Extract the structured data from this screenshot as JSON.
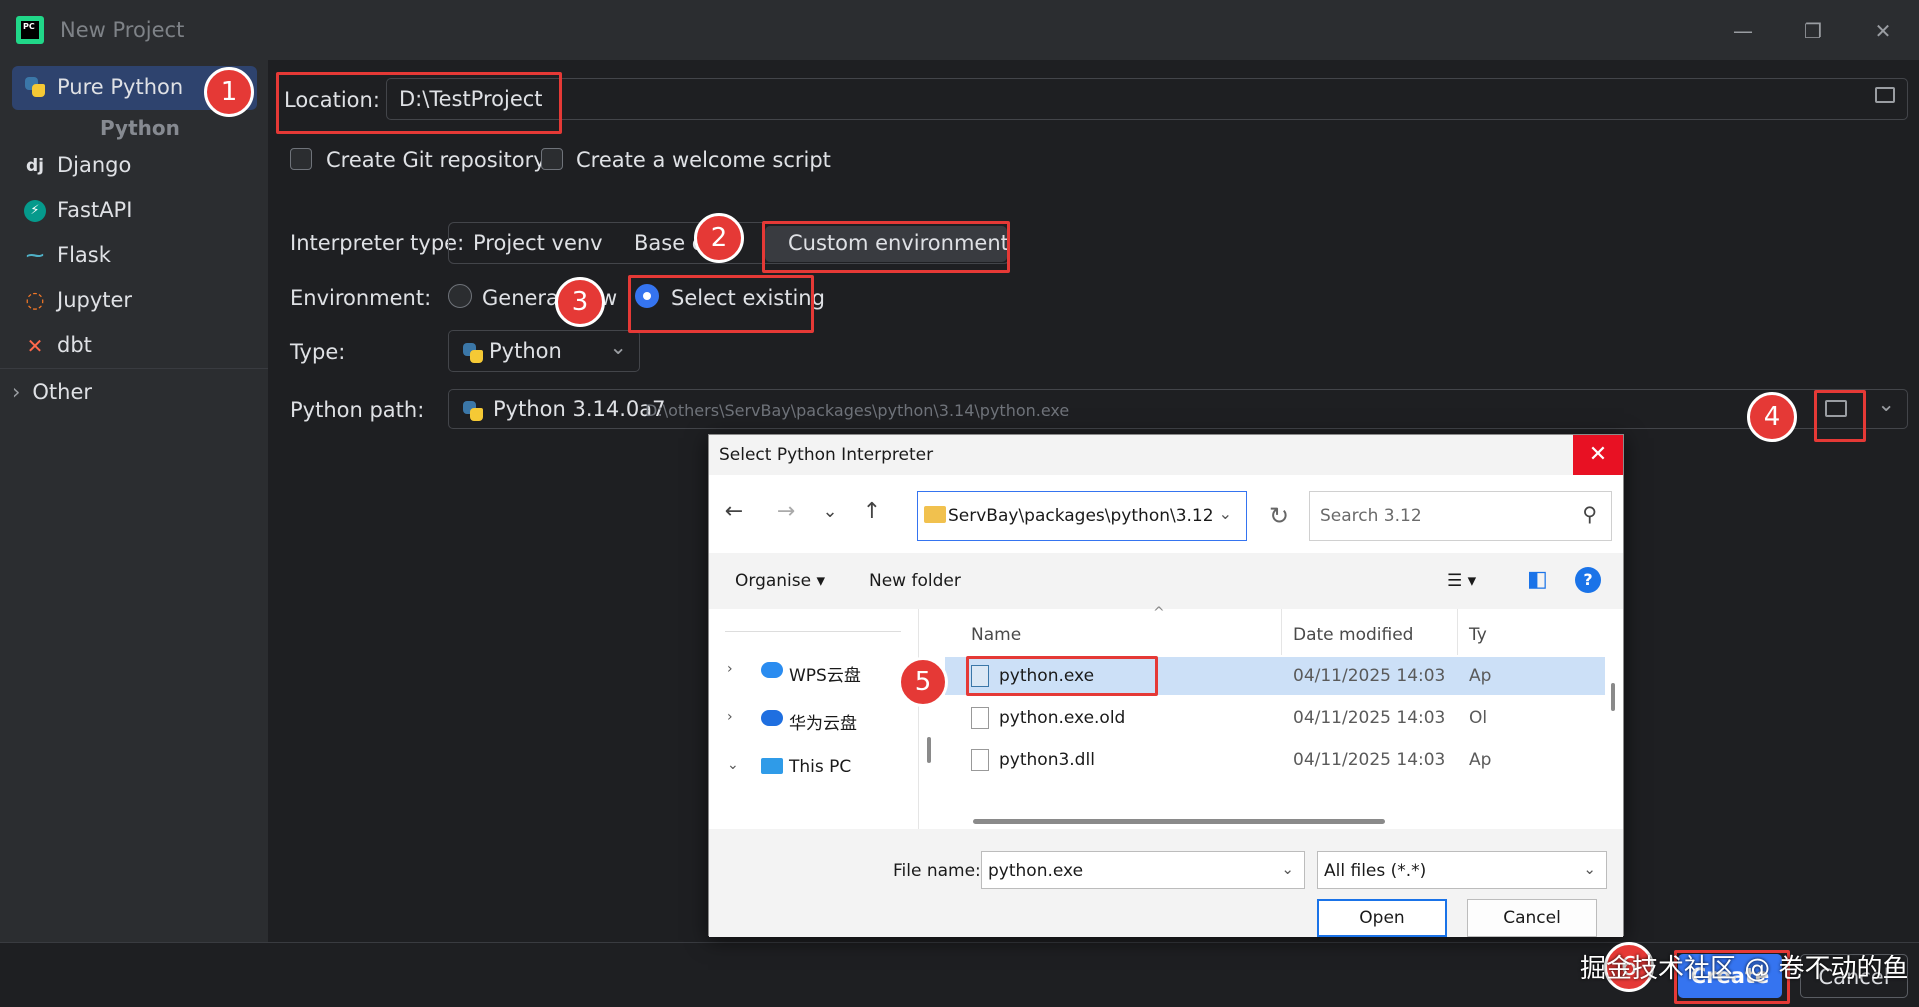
{
  "window": {
    "title": "New Project",
    "minimize": "—",
    "restore": "❐",
    "close": "✕"
  },
  "sidebar": {
    "items": [
      {
        "label": "Pure Python",
        "icon": "python-icon"
      },
      {
        "label": "Django",
        "icon": "django-icon",
        "glyph": "dj"
      },
      {
        "label": "FastAPI",
        "icon": "fastapi-icon",
        "glyph": "⚡"
      },
      {
        "label": "Flask",
        "icon": "flask-icon",
        "glyph": "⁓"
      },
      {
        "label": "Jupyter",
        "icon": "jupyter-icon",
        "glyph": "◌"
      },
      {
        "label": "dbt",
        "icon": "dbt-icon",
        "glyph": "✕"
      }
    ],
    "group_label": "Python",
    "other_label": "Other",
    "other_chevron": "›"
  },
  "form": {
    "location_label": "Location:",
    "location_value": "D:\\TestProject",
    "git_label": "Create Git repository",
    "welcome_label": "Create a welcome script",
    "interpreter_label": "Interpreter type:",
    "interp_options": [
      "Project venv",
      "Base c",
      "Custom environment"
    ],
    "environment_label": "Environment:",
    "env_generate": "Generat",
    "env_generate_tail": "w",
    "env_select": "Select existing",
    "type_label": "Type:",
    "type_value": "Python",
    "path_label": "Python path:",
    "path_version": "Python 3.14.0a7",
    "path_value": "D:\\others\\ServBay\\packages\\python\\3.14\\python.exe",
    "chevron": "⌄"
  },
  "badges": [
    "1",
    "2",
    "3",
    "4",
    "5",
    "6"
  ],
  "dialog": {
    "title": "Select Python Interpreter",
    "close": "✕",
    "back": "←",
    "forward": "→",
    "recent": "⌄",
    "up": "↑",
    "address": "ServBay\\packages\\python\\3.12",
    "refresh": "↻",
    "search_placeholder": "Search 3.12",
    "search_glyph": "⚲",
    "organise": "Organise ▾",
    "new_folder": "New folder",
    "view_glyph": "☰ ▾",
    "pane_glyph": "◧",
    "help": "?",
    "nav": [
      {
        "label": "WPS云盘",
        "exp": "›",
        "color": "#2a8cf0"
      },
      {
        "label": "华为云盘",
        "exp": "›",
        "color": "#1f6fe0"
      },
      {
        "label": "This PC",
        "exp": "⌄",
        "color": "#2f9be8"
      }
    ],
    "columns": {
      "name": "Name",
      "date": "Date modified",
      "type": "Ty"
    },
    "sort_glyph": "^",
    "files": [
      {
        "name": "python.exe",
        "date": "04/11/2025 14:03",
        "type": "Ap"
      },
      {
        "name": "python.exe.old",
        "date": "04/11/2025 14:03",
        "type": "Ol"
      },
      {
        "name": "python3.dll",
        "date": "04/11/2025 14:03",
        "type": "Ap"
      }
    ],
    "file_name_label": "File name:",
    "file_name_value": "python.exe",
    "filter": "All files (*.*)",
    "open": "Open",
    "cancel": "Cancel"
  },
  "footer": {
    "create": "Create",
    "cancel": "Cancel",
    "watermark": "掘金技术社区 @ 卷不动的鱼"
  },
  "colors": {
    "accent": "#3574f0",
    "highlight": "#e53936",
    "sidebar_bg": "#2b2d30",
    "main_bg": "#1e1f22"
  }
}
